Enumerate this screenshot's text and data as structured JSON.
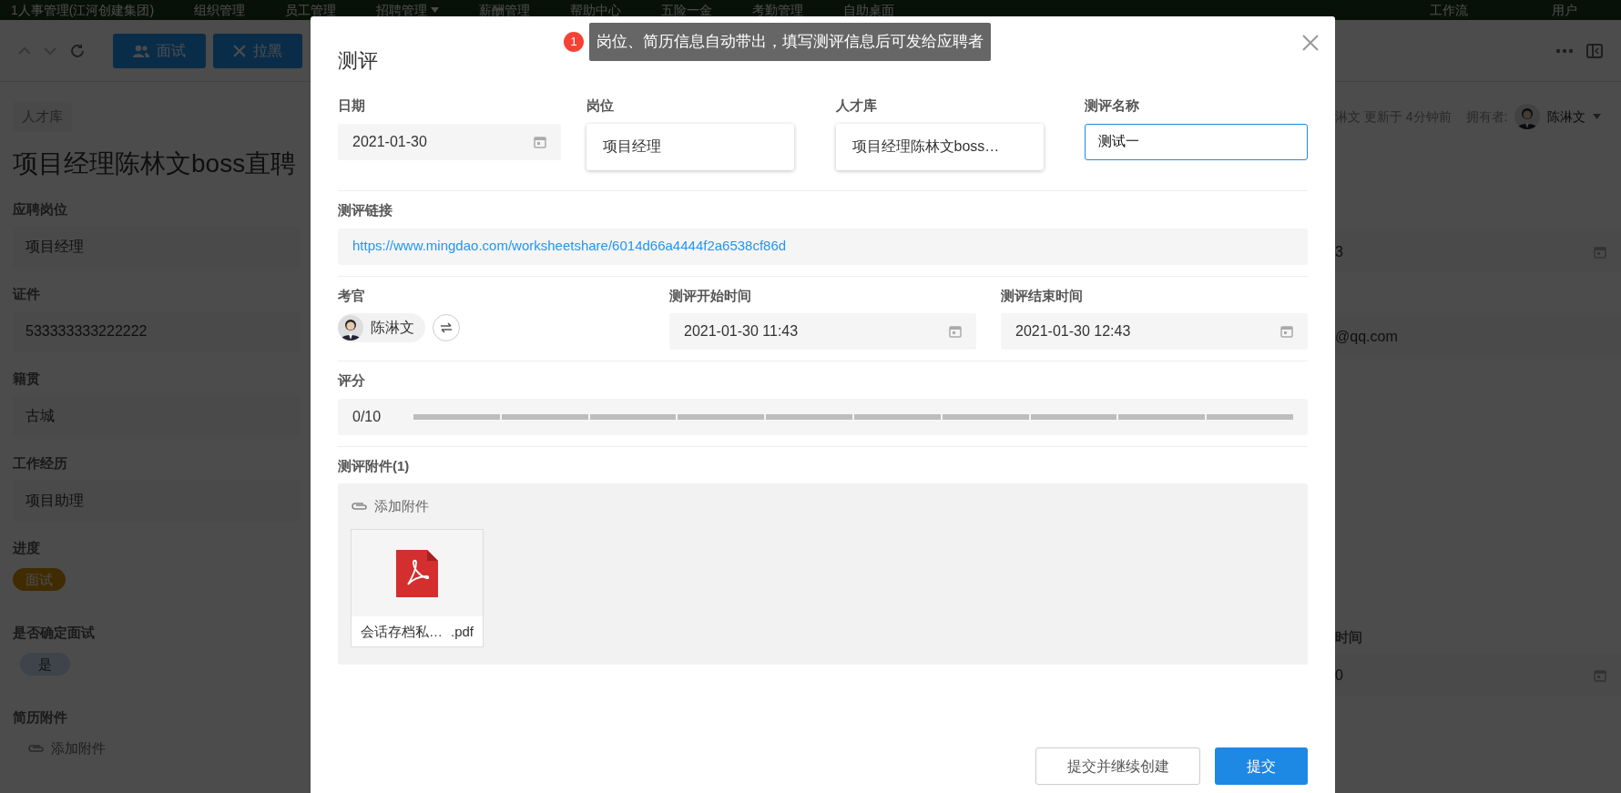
{
  "top_nav": {
    "app_name": "1人事管理(江河创建集团)",
    "items": [
      {
        "label": "组织管理",
        "dropdown": false
      },
      {
        "label": "员工管理",
        "dropdown": false
      },
      {
        "label": "招聘管理",
        "dropdown": true
      },
      {
        "label": "薪酬管理",
        "dropdown": false
      },
      {
        "label": "帮助中心",
        "dropdown": false
      },
      {
        "label": "五险一金",
        "dropdown": false
      },
      {
        "label": "考勤管理",
        "dropdown": false
      },
      {
        "label": "自助桌面",
        "dropdown": false
      }
    ],
    "right_items": [
      "工作流",
      "用户"
    ]
  },
  "toolbar": {
    "buttons": [
      {
        "label": "面试",
        "kind": "interview"
      },
      {
        "label": "拉黑",
        "kind": "block"
      }
    ]
  },
  "record": {
    "breadcrumb": "人才库",
    "title": "项目经理陈林文boss直聘",
    "updated": "淋文 更新于 4分钟前",
    "owner_label": "拥有者:",
    "owner": "陈淋文",
    "fields": [
      {
        "label": "应聘岗位",
        "value": "项目经理",
        "kind": "text"
      },
      {
        "label": "证件",
        "value": "533333333222222",
        "kind": "text"
      },
      {
        "label": "籍贯",
        "value": "古城",
        "kind": "text"
      },
      {
        "label": "工作经历",
        "value": "项目助理",
        "kind": "text"
      },
      {
        "label": "进度",
        "value": "面试",
        "kind": "tag"
      },
      {
        "label": "是否确定面试",
        "value": "是",
        "kind": "option"
      },
      {
        "label": "简历附件",
        "value": "添加附件",
        "kind": "attachment"
      }
    ],
    "right_fields": [
      {
        "value": "3",
        "kind": "date"
      },
      {
        "value": "@qq.com",
        "kind": "text"
      },
      {
        "label": "时间",
        "value": "0",
        "kind": "date"
      }
    ]
  },
  "dialog": {
    "title": "测评",
    "hint": {
      "badge": "1",
      "text": "岗位、简历信息自动带出，填写测评信息后可发给应聘者"
    },
    "fields": [
      {
        "label": "日期",
        "value": "2021-01-30",
        "kind": "date"
      },
      {
        "label": "岗位",
        "value": "项目经理",
        "kind": "relation"
      },
      {
        "label": "人才库",
        "value": "项目经理陈林文boss…",
        "kind": "relation"
      },
      {
        "label": "测评名称",
        "value": "测试一",
        "kind": "input",
        "focused": true
      }
    ],
    "link": {
      "label": "测评链接",
      "url": "https://www.mingdao.com/worksheetshare/6014d66a4444f2a6538cf86d"
    },
    "examiner": {
      "label": "考官",
      "name": "陈淋文"
    },
    "times": [
      {
        "label": "测评开始时间",
        "value": "2021-01-30 11:43"
      },
      {
        "label": "测评结束时间",
        "value": "2021-01-30 12:43"
      }
    ],
    "score": {
      "label": "评分",
      "reading": "0/10",
      "stars": 0
    },
    "attachments": {
      "label": "测评附件(1)",
      "add": "添加附件",
      "files": [
        {
          "name": "会话存档私…",
          "ext": ".pdf"
        }
      ]
    },
    "buttons": [
      {
        "label": "提交并继续创建",
        "kind": "secondary"
      },
      {
        "label": "提交",
        "kind": "primary"
      }
    ]
  }
}
